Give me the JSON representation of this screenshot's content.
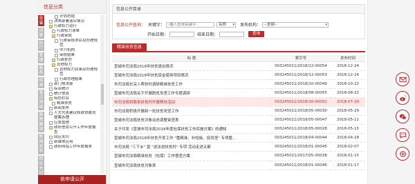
{
  "left": {
    "category_title": "信息分类",
    "vtabs": [
      {
        "label": "全省",
        "active": true
      },
      {
        "label": "决策",
        "active": false
      },
      {
        "label": "执行",
        "active": false
      },
      {
        "label": "管理",
        "active": false
      },
      {
        "label": "服务",
        "active": false
      },
      {
        "label": "结果",
        "active": false
      },
      {
        "label": "重点领域",
        "active": false
      },
      {
        "label": "政策解读",
        "active": false
      },
      {
        "label": "新闻发布",
        "active": false
      },
      {
        "label": "回应关切",
        "active": false
      }
    ],
    "tree": [
      {
        "label": "计划总结",
        "type": "doc",
        "indent": 12,
        "wrap": false
      },
      {
        "label": "决策部署落实情况",
        "type": "doc",
        "indent": 4,
        "wrap": false
      },
      {
        "label": "行政权力运行",
        "type": "folder",
        "indent": 4,
        "wrap": false
      },
      {
        "label": "行政权力清单",
        "type": "doc",
        "indent": 8,
        "wrap": false
      },
      {
        "label": "行政审批",
        "type": "folder",
        "indent": 8,
        "wrap": false
      },
      {
        "label": "行政审批项目及办理规范",
        "type": "doc",
        "indent": 12,
        "wrap": true
      },
      {
        "label": "中介机构",
        "type": "doc",
        "indent": 12,
        "wrap": false
      },
      {
        "label": "审批结果",
        "type": "doc",
        "indent": 12,
        "wrap": false
      },
      {
        "label": "行政处罚",
        "type": "folder",
        "indent": 8,
        "wrap": false
      },
      {
        "label": "其他权力",
        "type": "folder",
        "indent": 8,
        "wrap": false
      },
      {
        "label": "其他权力目录及办理规范",
        "type": "doc",
        "indent": 12,
        "wrap": true
      },
      {
        "label": "行政办理结果",
        "type": "doc",
        "indent": 12,
        "wrap": false
      },
      {
        "label": "部门预决算",
        "type": "doc",
        "indent": 4,
        "wrap": false
      },
      {
        "label": "综合统计",
        "type": "doc",
        "indent": 4,
        "wrap": false
      },
      {
        "label": "统计信息",
        "type": "doc",
        "indent": 4,
        "wrap": false
      },
      {
        "label": "特色栏目",
        "type": "folder",
        "indent": 4,
        "wrap": false
      },
      {
        "label": "精准扶贫",
        "type": "doc",
        "indent": 8,
        "wrap": false
      },
      {
        "label": "新闻发布",
        "type": "doc",
        "indent": 4,
        "wrap": false
      },
      {
        "label": "人大代表建议和政协委员提案办理",
        "type": "doc",
        "indent": 4,
        "wrap": true
      },
      {
        "label": "应急管理",
        "type": "doc",
        "indent": 4,
        "wrap": false
      },
      {
        "label": "政府信息公开工作年度报告",
        "type": "folder",
        "indent": 4,
        "wrap": true
      },
      {
        "label": "回应关切",
        "type": "doc",
        "indent": 4,
        "wrap": false
      },
      {
        "label": "新媒体应用",
        "type": "doc",
        "indent": 4,
        "wrap": false
      },
      {
        "label": "政府网站工作年度报表",
        "type": "doc",
        "indent": 4,
        "wrap": true
      }
    ],
    "bottom_button": "依申请公开"
  },
  "search": {
    "title": "信息公开目录",
    "query_label": "信息公开查询：",
    "keyword_label": "关键字：",
    "keyword_placeholder": "-输入查询关键字-",
    "field_select": "名称",
    "org_label": "发布机构：",
    "org_select": "--全部--",
    "start_label": "开始日期：",
    "end_label": "结束日期：",
    "query_button": "查询"
  },
  "list": {
    "tab_label": "精准扶贫信息",
    "headers": {
      "title": "标 题",
      "index": "索引号",
      "date": "发布时间"
    },
    "rows": [
      {
        "title": "宣城市司法局2018年扶贫退出情况",
        "index": "003245011/2018/12-00054",
        "date": "2018-12-24",
        "highlight": false
      },
      {
        "title": "宣城市司法局2018年扶贫资金使用项目情况",
        "index": "003245011/2018/12-00053",
        "date": "2018-12-24",
        "highlight": false
      },
      {
        "title": "市司法局长深入帮扶村调研精准扶贫工作",
        "index": "003245011/2018/10-00049",
        "date": "2018-10-22",
        "highlight": false
      },
      {
        "title": "宣城市司法局关于开展脱贫攻坚工作专题调研",
        "index": "003245011/2018/08-00055",
        "date": "2018-08-22",
        "highlight": false
      },
      {
        "title": "市司法局到联系扶贫村开展帮扶活动",
        "index": "003245011/2018/10-00052",
        "date": "2018-07-20",
        "highlight": true
      },
      {
        "title": "市司法局积极开展新一轮扶贫攻坚工作",
        "index": "003245011/2018/05-00030",
        "date": "2018-05-29",
        "highlight": false
      },
      {
        "title": "宣城市司法局扶贫对象动态调整审查表",
        "index": "003245011/2018/05-00047",
        "date": "2018-05-11",
        "highlight": false
      },
      {
        "title": "关于印发《宣城市司法局2018年度包保扶贫工作实施方案》的通知",
        "index": "003245011/2018/05-00028",
        "date": "2018-05-15",
        "highlight": false
      },
      {
        "title": "宣城市司法局2018年扶贫开发工作 \"重精准、补短板、促攻坚\" 专项整...",
        "index": "003245011/2018/04-00044",
        "date": "2018-04-18",
        "highlight": false
      },
      {
        "title": "市司法局 \"三下乡\" 暨 \"送法进扶贫村\" 专项 活动走进五都",
        "index": "003245011/2018/01-00045",
        "date": "2018-02-07",
        "highlight": false
      },
      {
        "title": "宣城市司法局精准扶贫（包保）工作督查方案",
        "index": "003245011/2017/05-00038",
        "date": "2018-01-15",
        "highlight": false
      },
      {
        "title": "宣城市司法局扶贫对象表",
        "index": "003245011/2018/01-00046",
        "date": "2018-01-17",
        "highlight": false
      }
    ]
  },
  "floaters": [
    {
      "icon": "mail-icon"
    },
    {
      "icon": "weibo-icon"
    },
    {
      "icon": "wechat-icon"
    },
    {
      "icon": "chat-icon"
    },
    {
      "icon": "toutiao-icon"
    }
  ],
  "colors": {
    "accent": "#c0292b"
  }
}
